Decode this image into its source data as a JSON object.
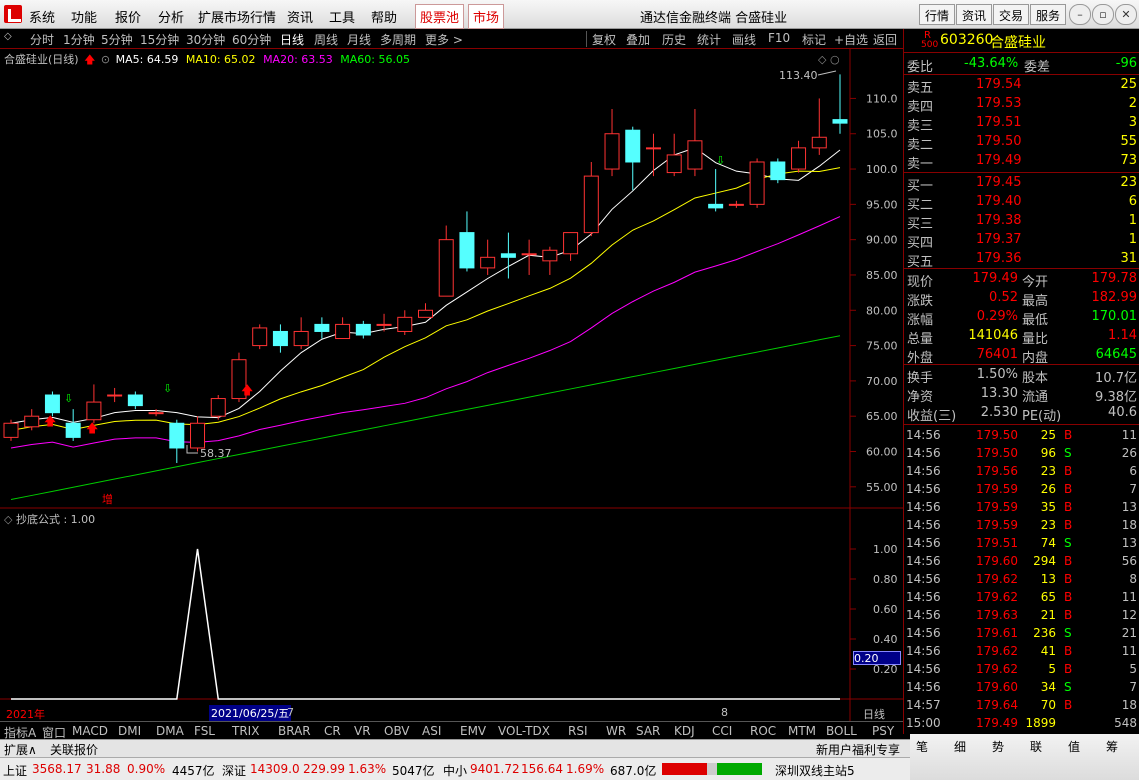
{
  "menubar": {
    "items": [
      "系统",
      "功能",
      "报价",
      "分析",
      "扩展市场行情",
      "资讯",
      "工具",
      "帮助"
    ],
    "stock_pool": "股票池",
    "market": "市场",
    "title": "通达信金融终端  合盛硅业",
    "buttons": [
      "行情",
      "资讯",
      "交易",
      "服务"
    ]
  },
  "toolbar": {
    "periods": [
      "分时",
      "1分钟",
      "5分钟",
      "15分钟",
      "30分钟",
      "60分钟",
      "日线",
      "周线",
      "月线",
      "多周期",
      "更多 >"
    ],
    "actions": [
      "复权",
      "叠加",
      "历史",
      "统计",
      "画线",
      "F10",
      "标记",
      "+自选",
      "返回"
    ]
  },
  "chart_header": {
    "name": "合盛硅业(日线)",
    "ma5": "MA5: 64.59",
    "ma10": "MA10: 65.02",
    "ma20": "MA20: 63.53",
    "ma60": "MA60: 56.05"
  },
  "price_axis": [
    "110.0",
    "105.0",
    "100.0",
    "95.00",
    "90.00",
    "85.00",
    "80.00",
    "75.00",
    "70.00",
    "65.00",
    "60.00",
    "55.00"
  ],
  "annotations": {
    "high": "113.40",
    "low": "58.37",
    "zeng": "增"
  },
  "indicator": {
    "title": "抄底公式 : 1.00",
    "axis": [
      "1.00",
      "0.80",
      "0.60",
      "0.40",
      "0.20"
    ],
    "current": "0.20"
  },
  "date_axis": {
    "year": "2021年",
    "cursor": "2021/06/25/五",
    "seven": "7",
    "eight": "8",
    "cycle": "日线"
  },
  "quote": {
    "code": "603260",
    "name": "合盛硅业",
    "r_label": "R",
    "r_num": "500",
    "weibi_label": "委比",
    "weibi": "-43.64%",
    "weicha_label": "委差",
    "weicha": "-96",
    "asks": [
      {
        "label": "卖五",
        "price": "179.54",
        "vol": "25"
      },
      {
        "label": "卖四",
        "price": "179.53",
        "vol": "2"
      },
      {
        "label": "卖三",
        "price": "179.51",
        "vol": "3"
      },
      {
        "label": "卖二",
        "price": "179.50",
        "vol": "55"
      },
      {
        "label": "卖一",
        "price": "179.49",
        "vol": "73"
      }
    ],
    "bids": [
      {
        "label": "买一",
        "price": "179.45",
        "vol": "23"
      },
      {
        "label": "买二",
        "price": "179.40",
        "vol": "6"
      },
      {
        "label": "买三",
        "price": "179.38",
        "vol": "1"
      },
      {
        "label": "买四",
        "price": "179.37",
        "vol": "1"
      },
      {
        "label": "买五",
        "price": "179.36",
        "vol": "31"
      }
    ],
    "stats": [
      {
        "l1": "现价",
        "v1": "179.49",
        "l2": "今开",
        "v2": "179.78"
      },
      {
        "l1": "涨跌",
        "v1": "0.52",
        "l2": "最高",
        "v2": "182.99"
      },
      {
        "l1": "涨幅",
        "v1": "0.29%",
        "l2": "最低",
        "v2": "170.01"
      },
      {
        "l1": "总量",
        "v1": "141046",
        "l2": "量比",
        "v2": "1.14"
      },
      {
        "l1": "外盘",
        "v1": "76401",
        "l2": "内盘",
        "v2": "64645"
      }
    ],
    "stats2": [
      {
        "l1": "换手",
        "v1": "1.50%",
        "l2": "股本",
        "v2": "10.7亿"
      },
      {
        "l1": "净资",
        "v1": "13.30",
        "l2": "流通",
        "v2": "9.38亿"
      },
      {
        "l1": "收益(三)",
        "v1": "2.530",
        "l2": "PE(动)",
        "v2": "40.6"
      }
    ]
  },
  "ticks": [
    {
      "t": "14:56",
      "p": "179.50",
      "v": "25",
      "d": "B",
      "n": "11"
    },
    {
      "t": "14:56",
      "p": "179.50",
      "v": "96",
      "d": "S",
      "n": "26"
    },
    {
      "t": "14:56",
      "p": "179.56",
      "v": "23",
      "d": "B",
      "n": "6"
    },
    {
      "t": "14:56",
      "p": "179.59",
      "v": "26",
      "d": "B",
      "n": "7"
    },
    {
      "t": "14:56",
      "p": "179.59",
      "v": "35",
      "d": "B",
      "n": "13"
    },
    {
      "t": "14:56",
      "p": "179.59",
      "v": "23",
      "d": "B",
      "n": "18"
    },
    {
      "t": "14:56",
      "p": "179.51",
      "v": "74",
      "d": "S",
      "n": "13"
    },
    {
      "t": "14:56",
      "p": "179.60",
      "v": "294",
      "d": "B",
      "n": "56"
    },
    {
      "t": "14:56",
      "p": "179.62",
      "v": "13",
      "d": "B",
      "n": "8"
    },
    {
      "t": "14:56",
      "p": "179.62",
      "v": "65",
      "d": "B",
      "n": "11"
    },
    {
      "t": "14:56",
      "p": "179.63",
      "v": "21",
      "d": "B",
      "n": "12"
    },
    {
      "t": "14:56",
      "p": "179.61",
      "v": "236",
      "d": "S",
      "n": "21"
    },
    {
      "t": "14:56",
      "p": "179.62",
      "v": "41",
      "d": "B",
      "n": "11"
    },
    {
      "t": "14:56",
      "p": "179.62",
      "v": "5",
      "d": "B",
      "n": "5"
    },
    {
      "t": "14:56",
      "p": "179.60",
      "v": "34",
      "d": "S",
      "n": "7"
    },
    {
      "t": "14:57",
      "p": "179.64",
      "v": "70",
      "d": "B",
      "n": "18"
    },
    {
      "t": "15:00",
      "p": "179.49",
      "v": "1899",
      "d": "",
      "n": "548"
    }
  ],
  "bottom_tabs": [
    "指标A",
    "窗口",
    "MACD",
    "DMI",
    "DMA",
    "FSL",
    "TRIX",
    "BRAR",
    "CR",
    "VR",
    "OBV",
    "ASI",
    "EMV",
    "VOL-TDX",
    "RSI",
    "WR",
    "SAR",
    "KDJ",
    "CCI",
    "ROC",
    "MTM",
    "BOLL",
    "PSY",
    "指标B",
    "模板",
    "+",
    "-"
  ],
  "status": {
    "expand": "扩展∧",
    "related": "关联报价",
    "sh_label": "上证",
    "sh": "3568.17",
    "sh_chg": "31.88",
    "sh_pct": "0.90%",
    "sh_amt": "4457亿",
    "sz_label": "深证",
    "sz": "14309.0",
    "sz_chg": "229.99",
    "sz_pct": "1.63%",
    "sz_amt": "5047亿",
    "zx_label": "中小",
    "zx": "9401.72",
    "zx_chg": "156.64",
    "zx_pct": "1.69%",
    "zx_amt": "687.0亿",
    "server": "深圳双线主站5",
    "promo": "新用户福利专享",
    "tabs": [
      "笔",
      "细",
      "势",
      "联",
      "值",
      "筹"
    ]
  },
  "chart_data": [
    {
      "type": "candlestick",
      "title": "合盛硅业(日线)",
      "ylim": [
        52,
        117
      ],
      "candles": [
        {
          "o": 62.0,
          "c": 64.0,
          "h": 64.5,
          "l": 61.5
        },
        {
          "o": 63.5,
          "c": 65.0,
          "h": 66.0,
          "l": 63.0
        },
        {
          "o": 68.0,
          "c": 65.5,
          "h": 68.5,
          "l": 65.0
        },
        {
          "o": 64.0,
          "c": 62.0,
          "h": 66.0,
          "l": 61.5
        },
        {
          "o": 64.5,
          "c": 67.0,
          "h": 69.5,
          "l": 64.0
        },
        {
          "o": 68.0,
          "c": 68.0,
          "h": 69.0,
          "l": 67.0
        },
        {
          "o": 68.0,
          "c": 66.5,
          "h": 68.5,
          "l": 66.0
        },
        {
          "o": 65.5,
          "c": 65.5,
          "h": 66.0,
          "l": 65.0
        },
        {
          "o": 64.0,
          "c": 60.5,
          "h": 64.5,
          "l": 58.37
        },
        {
          "o": 60.5,
          "c": 64.0,
          "h": 65.0,
          "l": 60.0
        },
        {
          "o": 65.0,
          "c": 67.5,
          "h": 68.0,
          "l": 64.5
        },
        {
          "o": 67.5,
          "c": 73.0,
          "h": 74.0,
          "l": 67.0
        },
        {
          "o": 75.0,
          "c": 77.5,
          "h": 78.0,
          "l": 74.5
        },
        {
          "o": 77.0,
          "c": 75.0,
          "h": 78.0,
          "l": 74.0
        },
        {
          "o": 75.0,
          "c": 77.0,
          "h": 79.0,
          "l": 74.5
        },
        {
          "o": 78.0,
          "c": 77.0,
          "h": 79.0,
          "l": 76.0
        },
        {
          "o": 76.0,
          "c": 78.0,
          "h": 79.0,
          "l": 76.0
        },
        {
          "o": 78.0,
          "c": 76.5,
          "h": 78.5,
          "l": 76.0
        },
        {
          "o": 78.0,
          "c": 78.0,
          "h": 79.5,
          "l": 77.0
        },
        {
          "o": 77.0,
          "c": 79.0,
          "h": 80.0,
          "l": 76.5
        },
        {
          "o": 79.0,
          "c": 80.0,
          "h": 81.0,
          "l": 79.0
        },
        {
          "o": 82.0,
          "c": 90.0,
          "h": 92.0,
          "l": 82.0
        },
        {
          "o": 91.0,
          "c": 86.0,
          "h": 94.0,
          "l": 85.5
        },
        {
          "o": 86.0,
          "c": 87.5,
          "h": 90.0,
          "l": 85.0
        },
        {
          "o": 88.0,
          "c": 87.5,
          "h": 91.0,
          "l": 84.5
        },
        {
          "o": 88.0,
          "c": 88.0,
          "h": 90.0,
          "l": 85.0
        },
        {
          "o": 87.0,
          "c": 88.5,
          "h": 89.0,
          "l": 85.0
        },
        {
          "o": 88.0,
          "c": 91.0,
          "h": 91.0,
          "l": 87.0
        },
        {
          "o": 91.0,
          "c": 99.0,
          "h": 101.0,
          "l": 90.5
        },
        {
          "o": 100.0,
          "c": 105.0,
          "h": 108.5,
          "l": 99.0
        },
        {
          "o": 105.5,
          "c": 101.0,
          "h": 106.0,
          "l": 97.0
        },
        {
          "o": 103.0,
          "c": 103.0,
          "h": 105.0,
          "l": 99.0
        },
        {
          "o": 99.5,
          "c": 102.0,
          "h": 105.0,
          "l": 99.0
        },
        {
          "o": 100.0,
          "c": 104.0,
          "h": 108.5,
          "l": 99.0
        },
        {
          "o": 95.0,
          "c": 94.5,
          "h": 100.0,
          "l": 94.0
        },
        {
          "o": 95.0,
          "c": 95.0,
          "h": 95.5,
          "l": 94.5
        },
        {
          "o": 95.0,
          "c": 101.0,
          "h": 101.5,
          "l": 94.5
        },
        {
          "o": 101.0,
          "c": 98.5,
          "h": 101.5,
          "l": 98.0
        },
        {
          "o": 100.0,
          "c": 103.0,
          "h": 104.0,
          "l": 99.5
        },
        {
          "o": 103.0,
          "c": 104.5,
          "h": 110.0,
          "l": 102.0
        },
        {
          "o": 107.0,
          "c": 106.5,
          "h": 113.4,
          "l": 105.0
        }
      ]
    },
    {
      "type": "line",
      "title": "抄底公式",
      "ylim": [
        0,
        1.2
      ],
      "x": [
        0,
        1,
        2,
        3,
        4,
        5,
        6,
        7,
        8,
        9,
        10,
        11,
        12,
        13,
        14,
        15,
        16,
        17,
        18,
        19,
        20,
        21,
        22,
        23,
        24,
        25,
        26,
        27,
        28,
        29,
        30,
        31,
        32,
        33,
        34,
        35,
        36,
        37,
        38,
        39,
        40
      ],
      "series": [
        {
          "name": "抄底公式",
          "values": [
            0,
            0,
            0,
            0,
            0,
            0,
            0,
            0,
            0,
            1,
            0,
            0,
            0,
            0,
            0,
            0,
            0,
            0,
            0,
            0,
            0,
            0,
            0,
            0,
            0,
            0,
            0,
            0,
            0,
            0,
            0,
            0,
            0,
            0,
            0,
            0,
            0,
            0,
            0,
            0,
            0
          ]
        }
      ]
    }
  ]
}
